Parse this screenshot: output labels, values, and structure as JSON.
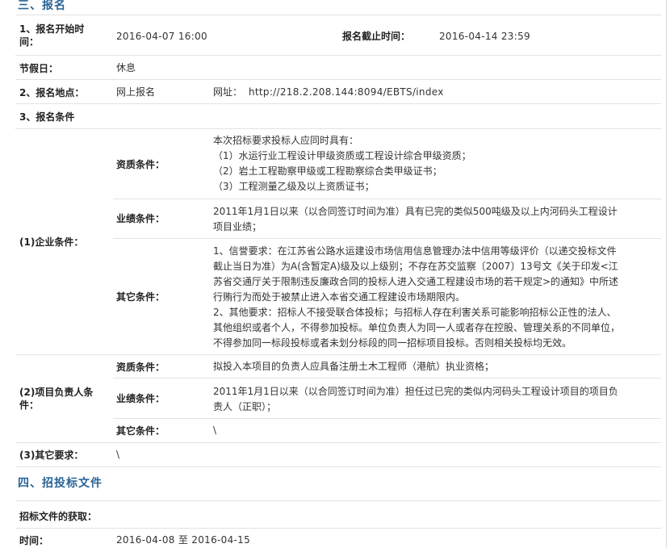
{
  "section3": {
    "title": "三、报名",
    "start_label": "1、报名开始时间：",
    "start_label_line1": "1、报名开始时",
    "start_label_line2": "间：",
    "start_value": "2016-04-07 16:00",
    "end_label": "报名截止时间：",
    "end_value": "2016-04-14 23:59",
    "holiday_label": "节假日：",
    "holiday_value": "休息",
    "place_label": "2、报名地点：",
    "place_value": "网上报名",
    "url_label": "网址：",
    "url_value": "http://218.2.208.144:8094/EBTS/index",
    "cond_label": "3、报名条件"
  },
  "enterprise": {
    "label": "(1)企业条件：",
    "qual_label": "资质条件：",
    "qual_lines": [
      "本次招标要求投标人应同时具有：",
      "（1）水运行业工程设计甲级资质或工程设计综合甲级资质；",
      "（2）岩土工程勘察甲级或工程勘察综合类甲级证书；",
      "（3）工程测量乙级及以上资质证书；"
    ],
    "perf_label": "业绩条件：",
    "perf_lines": [
      "2011年1月1日以来（以合同签订时间为准）具有已完的类似500吨级及以上内河码头工程设计",
      "项目业绩；"
    ],
    "other_label": "其它条件：",
    "other_lines": [
      "1、信誉要求：在江苏省公路水运建设市场信用信息管理办法中信用等级评价（以递交投标文件",
      "截止当日为准）为A(含暂定A)级及以上级别；不存在苏交监察〔2007〕13号文《关于印发<江",
      "苏省交通厅关于限制违反廉政合同的投标人进入交通工程建设市场的若干规定>的通知》中所述",
      "行贿行为而处于被禁止进入本省交通工程建设市场期限内。",
      "2、其他要求：招标人不接受联合体投标；与招标人存在利害关系可能影响招标公正性的法人、",
      "其他组织或者个人，不得参加投标。单位负责人为同一人或者存在控股、管理关系的不同单位，",
      "不得参加同一标段投标或者未划分标段的同一招标项目投标。否则相关投标均无效。"
    ]
  },
  "manager": {
    "label_line1": "(2)项目负责人条",
    "label_line2": "件：",
    "qual_label": "资质条件：",
    "qual_value": "拟投入本项目的负责人应具备注册土木工程师（港航）执业资格；",
    "perf_label": "业绩条件：",
    "perf_lines": [
      "2011年1月1日以来（以合同签订时间为准）担任过已完的类似内河码头工程设计项目的项目负",
      "责人（正职）；"
    ],
    "other_label": "其它条件：",
    "other_value": "\\"
  },
  "other_req": {
    "label": "(3)其它要求：",
    "value": "\\"
  },
  "section4": {
    "title": "四、招投标文件",
    "obtain_label": "招标文件的获取：",
    "time_label": "时间：",
    "time_value": "2016-04-08 至 2016-04-15"
  }
}
